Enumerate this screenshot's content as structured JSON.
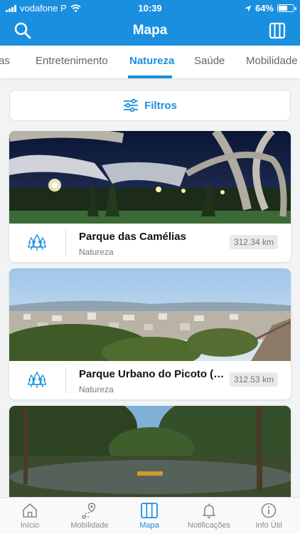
{
  "status_bar": {
    "carrier": "vodafone P",
    "time": "10:39",
    "battery": "64%",
    "battery_level": 0.64
  },
  "header": {
    "title": "Mapa",
    "search_icon": "search-icon",
    "book_icon": "book-icon"
  },
  "tabs": [
    {
      "label": "as"
    },
    {
      "label": "Entretenimento"
    },
    {
      "label": "Natureza",
      "active": true
    },
    {
      "label": "Saúde"
    },
    {
      "label": "Mobilidade"
    }
  ],
  "filter": {
    "label": "Filtros",
    "icon": "sliders-icon"
  },
  "places": [
    {
      "name": "Parque das Camélias",
      "category": "Natureza",
      "distance": "312.34 km",
      "icon": "trees-icon"
    },
    {
      "name": "Parque Urbano do Picoto (Mirante)",
      "category": "Natureza",
      "distance": "312.53 km",
      "icon": "trees-icon"
    },
    {
      "name": "",
      "category": "",
      "distance": "",
      "icon": "trees-icon"
    }
  ],
  "bottom_nav": [
    {
      "label": "Início",
      "icon": "home-icon"
    },
    {
      "label": "Mobilidade",
      "icon": "route-pin-icon"
    },
    {
      "label": "Mapa",
      "icon": "map-icon",
      "active": true
    },
    {
      "label": "Notificações",
      "icon": "bell-icon"
    },
    {
      "label": "Info Útil",
      "icon": "info-icon"
    }
  ],
  "colors": {
    "accent": "#1a8fe0",
    "text": "#111111",
    "muted": "#777777",
    "badge_bg": "#e7e9ec"
  }
}
